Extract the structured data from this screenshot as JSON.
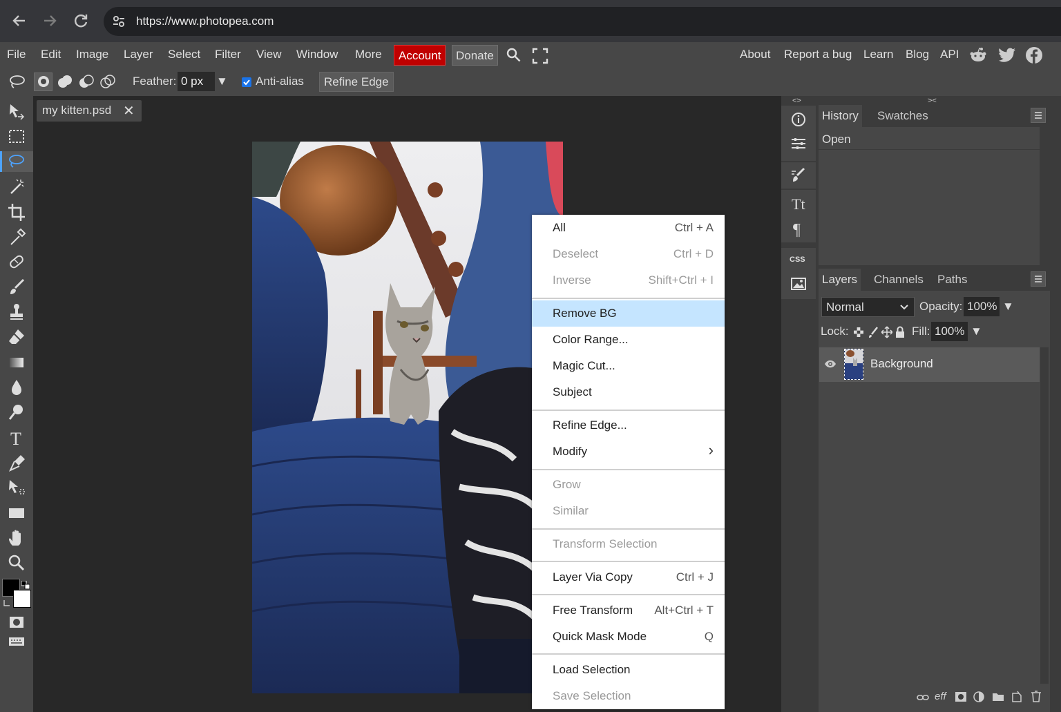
{
  "browser": {
    "url": "https://www.photopea.com",
    "icons": [
      "back-arrow-icon",
      "forward-arrow-icon",
      "reload-icon",
      "site-settings-icon"
    ]
  },
  "menubar": {
    "items": [
      "File",
      "Edit",
      "Image",
      "Layer",
      "Select",
      "Filter",
      "View",
      "Window",
      "More"
    ],
    "account": "Account",
    "donate": "Donate",
    "right_links": [
      "About",
      "Report a bug",
      "Learn",
      "Blog",
      "API"
    ],
    "social_icons": [
      "reddit-icon",
      "twitter-icon",
      "facebook-icon"
    ],
    "account_color": "#c00000"
  },
  "options": {
    "feather_label": "Feather:",
    "feather_value": "0 px",
    "antialias_label": "Anti-alias",
    "antialias_checked": true,
    "refine_edge": "Refine Edge"
  },
  "document": {
    "tab_name": "my kitten.psd",
    "close": "✕"
  },
  "context_menu": {
    "items": [
      {
        "label": "All",
        "shortcut": "Ctrl + A",
        "disabled": false
      },
      {
        "label": "Deselect",
        "shortcut": "Ctrl + D",
        "disabled": true
      },
      {
        "label": "Inverse",
        "shortcut": "Shift+Ctrl + I",
        "disabled": true
      },
      {
        "label": "Remove BG",
        "shortcut": "",
        "disabled": false,
        "highlighted": true
      },
      {
        "label": "Color Range...",
        "shortcut": "",
        "disabled": false
      },
      {
        "label": "Magic Cut...",
        "shortcut": "",
        "disabled": false
      },
      {
        "label": "Subject",
        "shortcut": "",
        "disabled": false
      },
      {
        "label": "Refine Edge...",
        "shortcut": "",
        "disabled": false
      },
      {
        "label": "Modify",
        "shortcut": "›",
        "disabled": false
      },
      {
        "label": "Grow",
        "shortcut": "",
        "disabled": true
      },
      {
        "label": "Similar",
        "shortcut": "",
        "disabled": true
      },
      {
        "label": "Transform Selection",
        "shortcut": "",
        "disabled": true
      },
      {
        "label": "Layer Via Copy",
        "shortcut": "Ctrl + J",
        "disabled": false
      },
      {
        "label": "Free Transform",
        "shortcut": "Alt+Ctrl + T",
        "disabled": false
      },
      {
        "label": "Quick Mask Mode",
        "shortcut": "Q",
        "disabled": false
      },
      {
        "label": "Load Selection",
        "shortcut": "",
        "disabled": false
      },
      {
        "label": "Save Selection",
        "shortcut": "",
        "disabled": true
      }
    ],
    "highlight_color": "#c5e5ff"
  },
  "history_panel": {
    "tabs": [
      "History",
      "Swatches"
    ],
    "entries": [
      "Open"
    ],
    "collapse_left": "<>",
    "collapse_right": "><"
  },
  "layers_panel": {
    "tabs": [
      "Layers",
      "Channels",
      "Paths"
    ],
    "blend_mode": "Normal",
    "opacity_label": "Opacity:",
    "opacity_value": "100%",
    "lock_label": "Lock:",
    "fill_label": "Fill:",
    "fill_value": "100%",
    "layers": [
      {
        "name": "Background",
        "visible": true
      }
    ],
    "footer_icons": [
      "link-icon",
      "effects-icon",
      "mask-icon",
      "adjustment-icon",
      "folder-icon",
      "new-layer-icon",
      "trash-icon"
    ],
    "effects_label": "eff"
  },
  "icon_strip": {
    "css_label": "CSS"
  }
}
